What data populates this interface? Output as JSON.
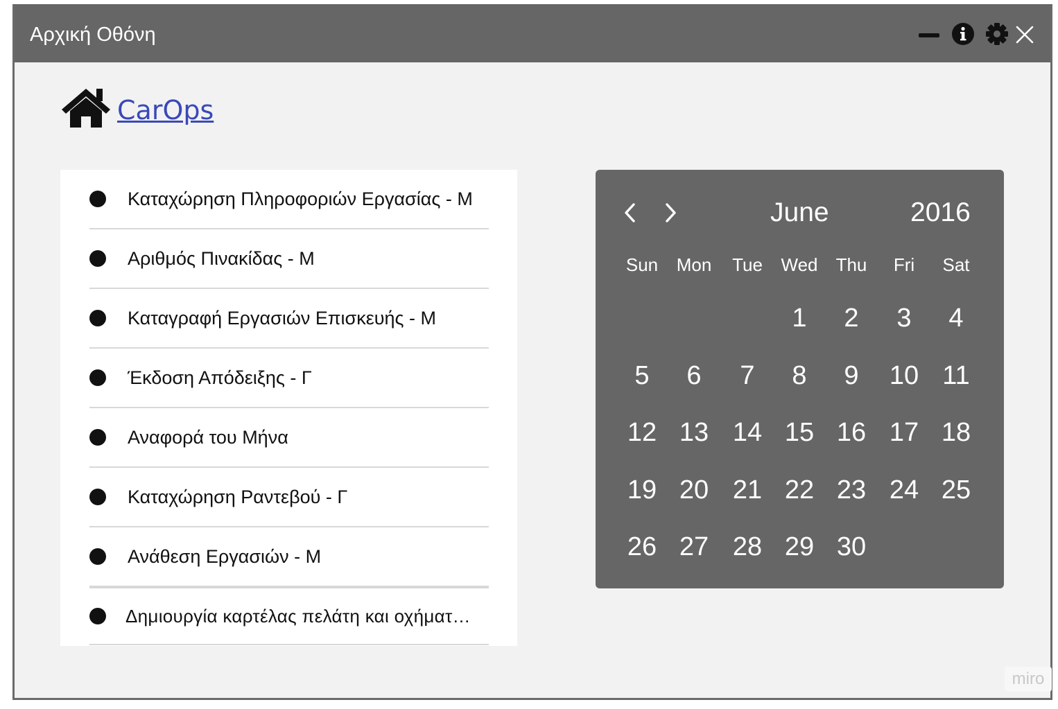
{
  "window": {
    "title": "Αρχική Οθόνη",
    "controls": [
      "minimize-icon",
      "info-icon",
      "gear-icon",
      "close-icon"
    ]
  },
  "brand": {
    "icon": "home-icon",
    "link_text": "CarOps",
    "link_color": "#3a49b8"
  },
  "menu": {
    "items": [
      {
        "label": "Καταχώρηση Πληροφοριών Εργασίας - Μ"
      },
      {
        "label": "Αριθμός Πινακίδας - Μ"
      },
      {
        "label": "Καταγραφή Εργασιών Επισκευής - Μ"
      },
      {
        "label": "Έκδοση Απόδειξης - Γ"
      },
      {
        "label": "Αναφορά του Μήνα"
      },
      {
        "label": "Καταχώρηση Ραντεβού - Γ"
      },
      {
        "label": "Ανάθεση Εργασιών - Μ"
      },
      {
        "label": "Δημιουργία καρτέλας πελάτη και οχήματ…"
      }
    ]
  },
  "calendar": {
    "month": "June",
    "year": "2016",
    "weekdays": [
      "Sun",
      "Mon",
      "Tue",
      "Wed",
      "Thu",
      "Fri",
      "Sat"
    ],
    "days": [
      "1",
      "2",
      "3",
      "4",
      "5",
      "6",
      "7",
      "8",
      "9",
      "10",
      "11",
      "12",
      "13",
      "14",
      "15",
      "16",
      "17",
      "18",
      "19",
      "20",
      "21",
      "22",
      "23",
      "24",
      "25",
      "26",
      "27",
      "28",
      "29",
      "30"
    ],
    "first_weekday_index": 3,
    "background": "#666666"
  },
  "watermark": {
    "text": "miro"
  },
  "colors": {
    "titlebar": "#666666",
    "window_bg": "#f2f2f2",
    "panel_bg": "#ffffff"
  }
}
